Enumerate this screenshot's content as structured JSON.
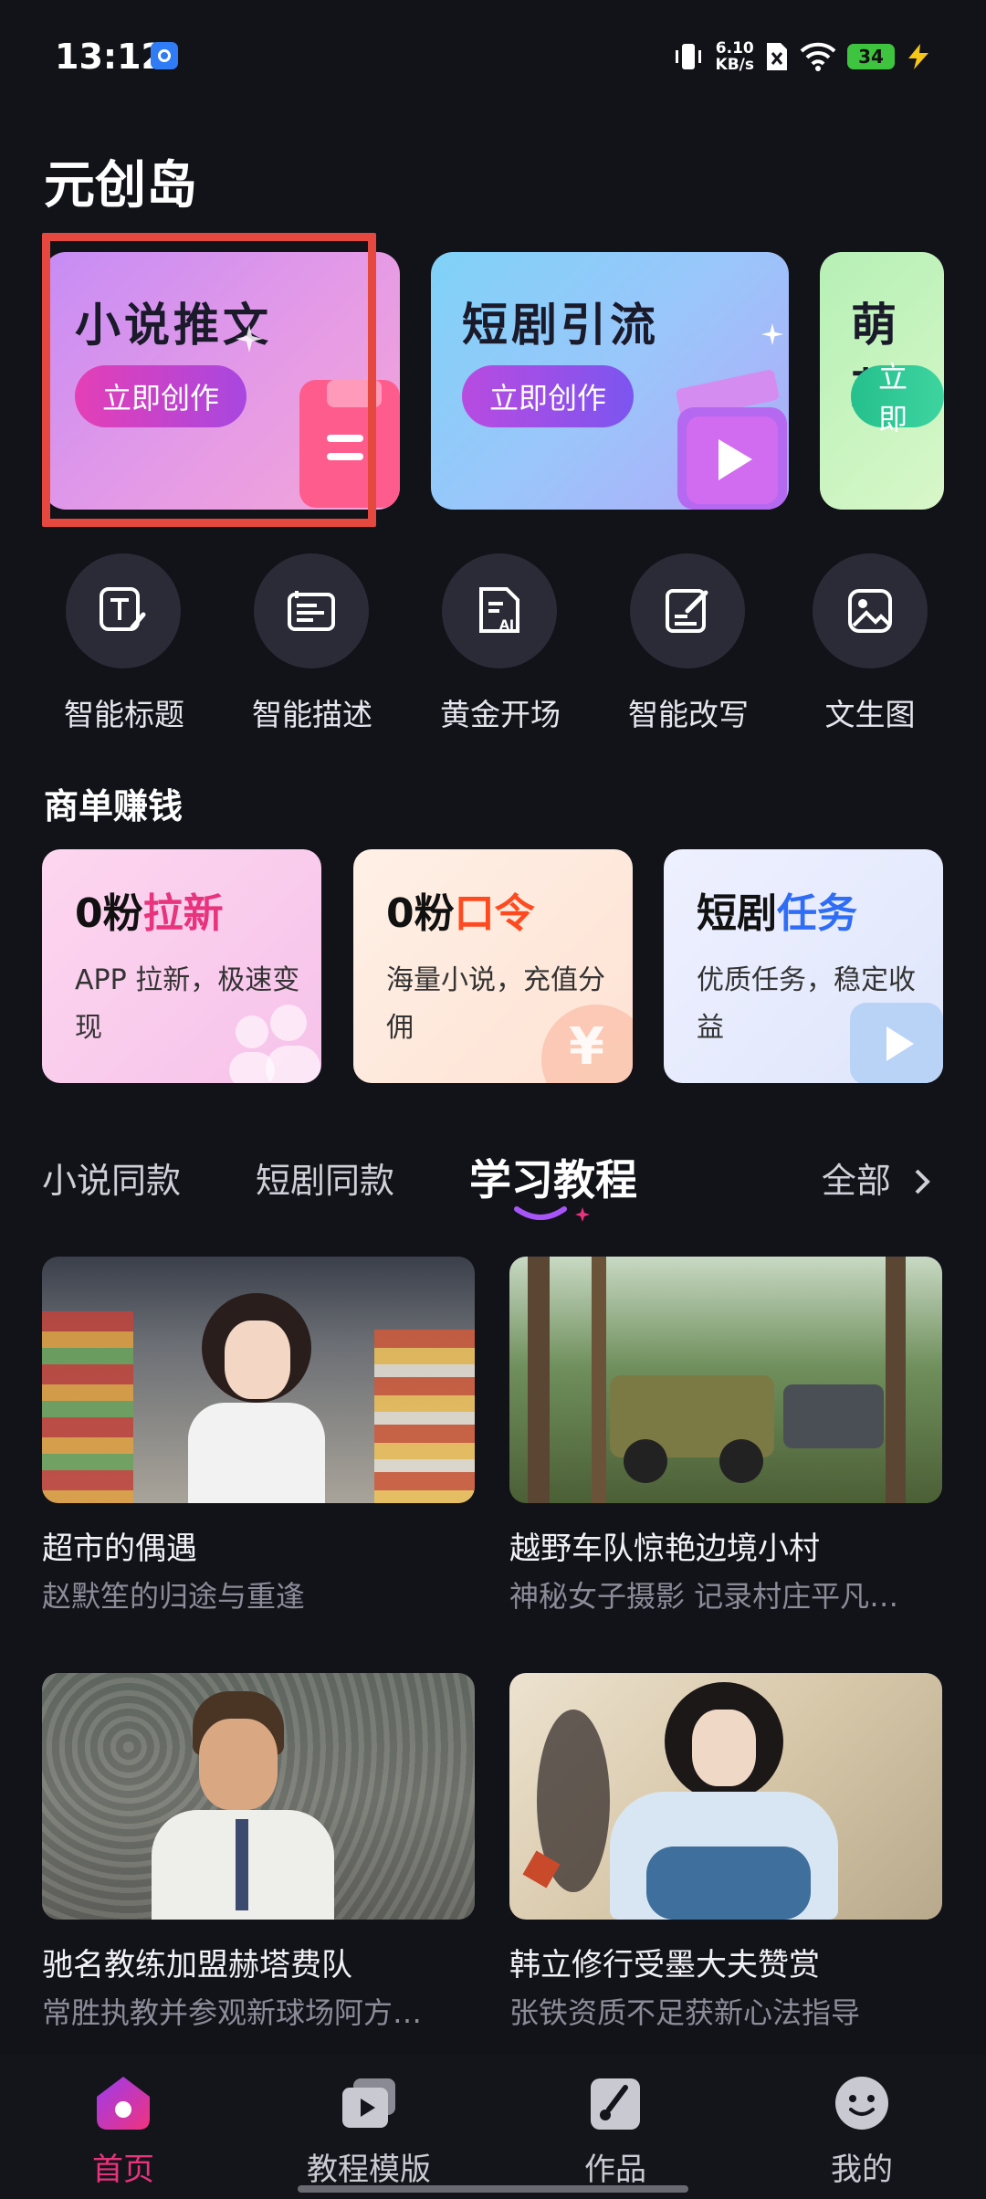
{
  "status_bar": {
    "time": "13:12",
    "speed_value": "6.10",
    "speed_unit": "KB/s",
    "battery": "34"
  },
  "app": {
    "title": "元创岛"
  },
  "banners": [
    {
      "title": "小说推文",
      "button": "立即创作"
    },
    {
      "title": "短剧引流",
      "button": "立即创作"
    },
    {
      "title": "萌芽",
      "button": "立即"
    }
  ],
  "tools": [
    {
      "label": "智能标题",
      "icon": "title-t-icon"
    },
    {
      "label": "智能描述",
      "icon": "description-icon"
    },
    {
      "label": "黄金开场",
      "icon": "ai-doc-icon"
    },
    {
      "label": "智能改写",
      "icon": "edit-doc-icon"
    },
    {
      "label": "文生图",
      "icon": "image-icon"
    }
  ],
  "earn": {
    "title": "商单赚钱",
    "cards": [
      {
        "title_prefix": "0粉",
        "title_accent": "拉新",
        "desc": "APP 拉新，极速变现",
        "accent": "#e8337d"
      },
      {
        "title_prefix": "0粉",
        "title_accent": "口令",
        "desc": "海量小说，充值分佣",
        "accent": "#ff4a1f"
      },
      {
        "title_prefix": "短剧",
        "title_accent": "任务",
        "desc": "优质任务，稳定收益",
        "accent": "#2f6df6"
      }
    ]
  },
  "tabs": {
    "items": [
      "小说同款",
      "短剧同款",
      "学习教程"
    ],
    "active": "学习教程",
    "all": "全部"
  },
  "grid": [
    {
      "title": "超市的偶遇",
      "subtitle": "赵默笙的归途与重逢"
    },
    {
      "title": "越野车队惊艳边境小村",
      "subtitle": "神秘女子摄影 记录村庄平凡…"
    },
    {
      "title": "驰名教练加盟赫塔费队",
      "subtitle": "常胜执教并参观新球场阿方…"
    },
    {
      "title": "韩立修行受墨大夫赞赏",
      "subtitle": "张铁资质不足获新心法指导"
    }
  ],
  "nav": [
    {
      "label": "首页",
      "icon": "home-icon",
      "active": true
    },
    {
      "label": "教程模版",
      "icon": "video-template-icon",
      "active": false
    },
    {
      "label": "作品",
      "icon": "works-brush-icon",
      "active": false
    },
    {
      "label": "我的",
      "icon": "profile-face-icon",
      "active": false
    }
  ]
}
